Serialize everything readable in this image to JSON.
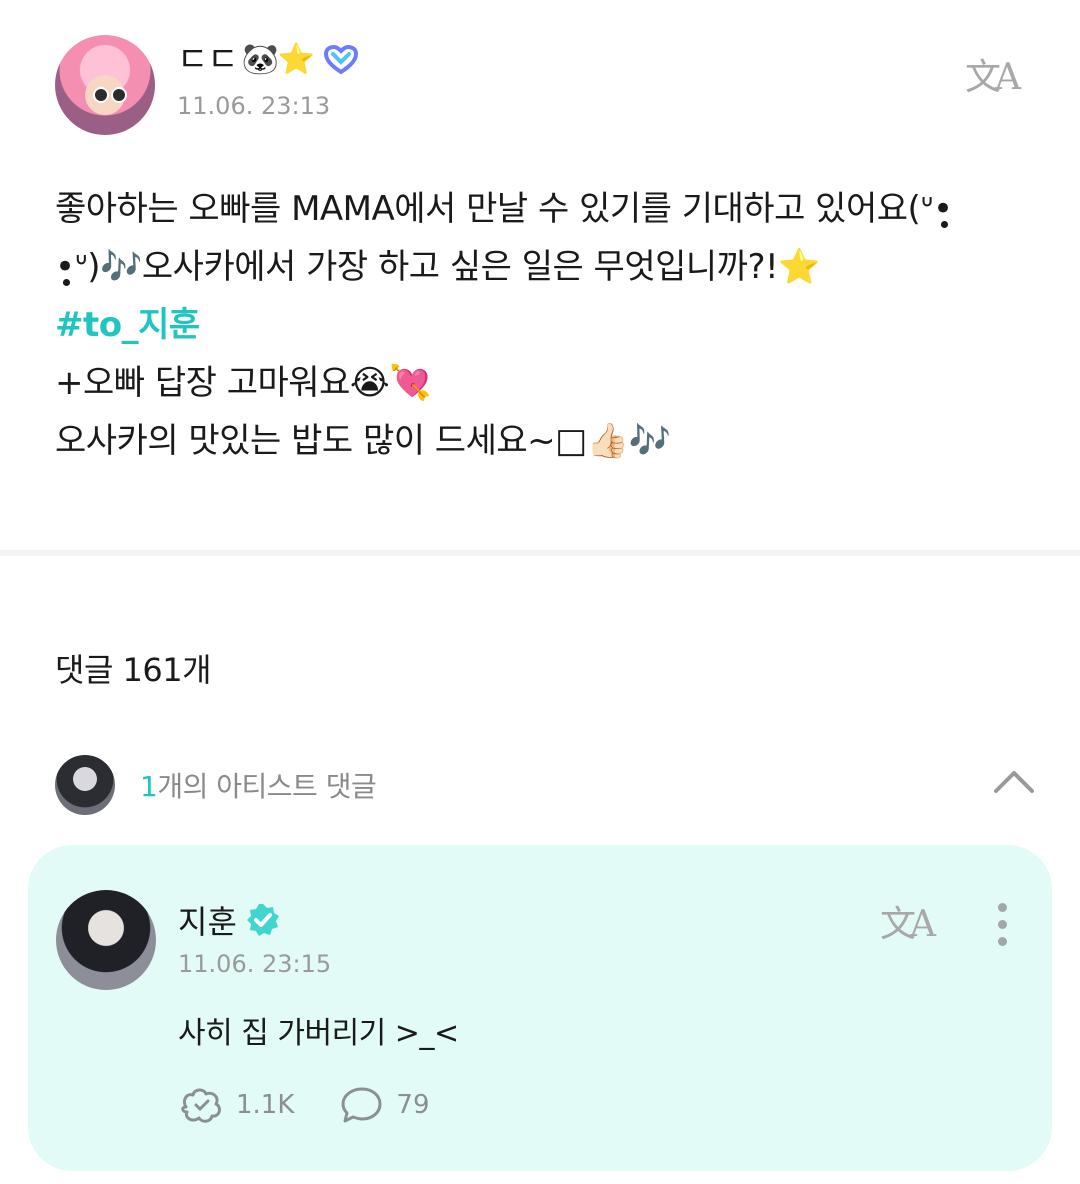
{
  "post": {
    "author_name": "ㄷㄷ",
    "author_emoji": "🐼⭐",
    "time": "11.06. 23:13",
    "body_lines": [
      "좋아하는 오빠를 MAMA에서 만날 수 있기를 기대하고 있어요(ᐡ•̥̣",
      "•̥̣ᐡ)🎶오사카에서 가장 하고 싶은 일은 무엇입니까?!⭐"
    ],
    "hashtag": "#to_지훈",
    "body_lines_after": [
      "+오빠 답장 고마워요😭💘",
      " 오사카의 맛있는 밥도 많이 드세요~□👍🏻🎶"
    ]
  },
  "comments": {
    "header": "댓글 161개",
    "artist_count_num": "1",
    "artist_count_text": "개의 아티스트 댓글"
  },
  "artist_comment": {
    "name": "지훈",
    "time": "11.06. 23:15",
    "text": "사히 집 가버리기 >_<",
    "likes": "1.1K",
    "replies": "79"
  },
  "icons": {
    "translate": "translate-icon",
    "verified": "verified-icon",
    "collapse": "chevron-up-icon",
    "more": "more-vertical-icon",
    "like": "like-icon",
    "reply": "reply-icon"
  },
  "colors": {
    "accent": "#20c5c0",
    "card_bg": "#e3fbf7",
    "muted_text": "#9a9a9a"
  }
}
